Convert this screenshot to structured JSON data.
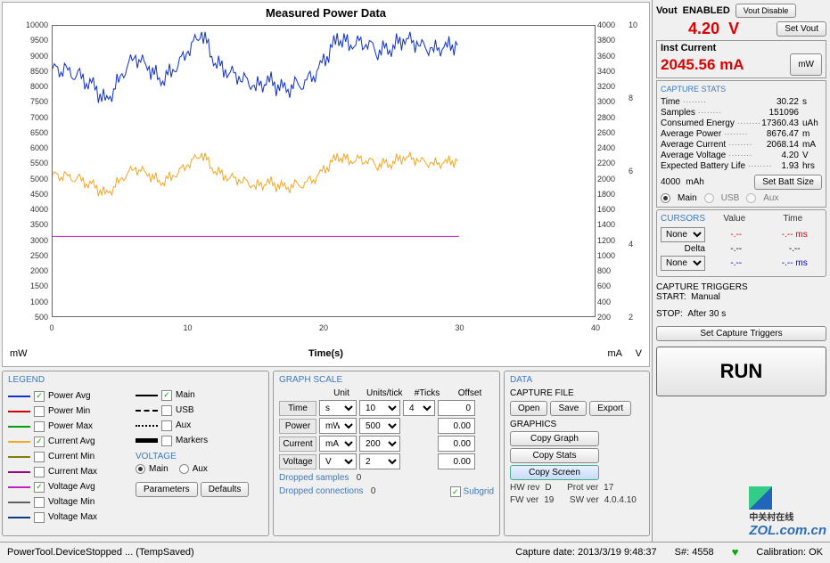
{
  "chart": {
    "title": "Measured Power Data",
    "xlabel": "Time(s)",
    "left_unit": "mW",
    "right_unit1": "mA",
    "right_unit2": "V",
    "x_ticks": [
      0,
      10,
      20,
      30,
      40
    ],
    "y_left_ticks": [
      500,
      1000,
      1500,
      2000,
      2500,
      3000,
      3500,
      4000,
      4500,
      5000,
      5500,
      6000,
      6500,
      7000,
      7500,
      8000,
      8500,
      9000,
      9500,
      10000
    ],
    "y_right1_ticks": [
      200,
      400,
      600,
      800,
      1000,
      1200,
      1400,
      1600,
      1800,
      2000,
      2200,
      2400,
      2600,
      2800,
      3000,
      3200,
      3400,
      3600,
      3800,
      4000
    ],
    "y_right2_ticks": [
      2,
      4,
      6,
      8,
      10
    ]
  },
  "chart_data": {
    "type": "line",
    "title": "Measured Power Data",
    "xlabel": "Time(s)",
    "xlim": [
      0,
      40
    ],
    "series": [
      {
        "name": "Power Avg",
        "unit": "mW",
        "ylim": [
          500,
          10000
        ],
        "color": "#1030d0",
        "x": [
          0,
          1,
          2,
          3,
          4,
          5,
          6,
          7,
          8,
          9,
          10,
          11,
          12,
          13,
          14,
          15,
          16,
          17,
          18,
          19,
          20,
          21,
          22,
          23,
          24,
          25,
          26,
          27,
          28,
          29,
          30
        ],
        "y": [
          8600,
          8500,
          8300,
          8000,
          7500,
          8300,
          9000,
          8700,
          8200,
          8600,
          9200,
          9800,
          8800,
          8500,
          8300,
          8000,
          8200,
          7900,
          8000,
          8200,
          8800,
          9600,
          9400,
          9500,
          9200,
          9300,
          9600,
          9400,
          9200,
          9300,
          9400
        ]
      },
      {
        "name": "Current Avg",
        "unit": "mA",
        "ylim": [
          200,
          4000
        ],
        "color": "#f5a623",
        "x": [
          0,
          1,
          2,
          3,
          4,
          5,
          6,
          7,
          8,
          9,
          10,
          11,
          12,
          13,
          14,
          15,
          16,
          17,
          18,
          19,
          20,
          21,
          22,
          23,
          24,
          25,
          26,
          27,
          28,
          29,
          30
        ],
        "y": [
          2050,
          2020,
          1980,
          1900,
          1790,
          1980,
          2140,
          2070,
          1950,
          2050,
          2190,
          2330,
          2100,
          2020,
          1980,
          1900,
          1950,
          1880,
          1900,
          1950,
          2100,
          2290,
          2240,
          2260,
          2190,
          2210,
          2290,
          2240,
          2190,
          2210,
          2240
        ]
      },
      {
        "name": "Voltage Avg",
        "unit": "V",
        "ylim": [
          2,
          10
        ],
        "color": "#c020c0",
        "x": [
          0,
          30
        ],
        "y": [
          4.2,
          4.2
        ]
      }
    ]
  },
  "legend": {
    "title": "LEGEND",
    "left": [
      {
        "label": "Power Avg",
        "color": "#1030d0",
        "checked": true
      },
      {
        "label": "Power Min",
        "color": "#d00000",
        "checked": false
      },
      {
        "label": "Power Max",
        "color": "#00a000",
        "checked": false
      },
      {
        "label": "Current Avg",
        "color": "#f5a623",
        "checked": true
      },
      {
        "label": "Current Min",
        "color": "#808000",
        "checked": false
      },
      {
        "label": "Current Max",
        "color": "#a00080",
        "checked": false
      },
      {
        "label": "Voltage Avg",
        "color": "#c020c0",
        "checked": true
      },
      {
        "label": "Voltage Min",
        "color": "#606060",
        "checked": false
      },
      {
        "label": "Voltage Max",
        "color": "#004080",
        "checked": false
      }
    ],
    "right": [
      {
        "label": "Main",
        "style": "solid",
        "checked": true
      },
      {
        "label": "USB",
        "style": "dashed",
        "checked": false
      },
      {
        "label": "Aux",
        "style": "dotted",
        "checked": false
      },
      {
        "label": "Markers",
        "style": "thick",
        "checked": false
      }
    ],
    "voltage_label": "VOLTAGE",
    "voltage_main": "Main",
    "voltage_aux": "Aux",
    "btn_params": "Parameters",
    "btn_defaults": "Defaults"
  },
  "graphscale": {
    "title": "GRAPH SCALE",
    "hdr_unit": "Unit",
    "hdr_upt": "Units/tick",
    "hdr_ticks": "#Ticks",
    "hdr_off": "Offset",
    "rows": [
      {
        "label": "Time",
        "unit": "s",
        "upt": "10",
        "ticks": "4",
        "off": "0"
      },
      {
        "label": "Power",
        "unit": "mW",
        "upt": "500",
        "ticks": "",
        "off": "0.00"
      },
      {
        "label": "Current",
        "unit": "mA",
        "upt": "200",
        "ticks": "",
        "off": "0.00"
      },
      {
        "label": "Voltage",
        "unit": "V",
        "upt": "2",
        "ticks": "",
        "off": "0.00"
      }
    ],
    "dropped_samples_lbl": "Dropped samples",
    "dropped_samples": "0",
    "dropped_conn_lbl": "Dropped connections",
    "dropped_conn": "0",
    "subgrid": "Subgrid"
  },
  "data": {
    "title": "DATA",
    "capfile": "CAPTURE FILE",
    "open": "Open",
    "save": "Save",
    "export": "Export",
    "graphics": "GRAPHICS",
    "copygraph": "Copy Graph",
    "copystats": "Copy Stats",
    "copyscreen": "Copy Screen",
    "hw_lbl": "HW rev",
    "hw": "D",
    "fw_lbl": "FW ver",
    "fw": "19",
    "prot_lbl": "Prot ver",
    "prot": "17",
    "sw_lbl": "SW ver",
    "sw": "4.0.4.10"
  },
  "right": {
    "vout_lbl": "Vout",
    "enabled": "ENABLED",
    "vout_val": "4.20",
    "vout_unit": "V",
    "btn_disable": "Vout Disable",
    "btn_setvout": "Set Vout",
    "inst_lbl": "Inst Current",
    "inst_val": "2045.56",
    "inst_unit": "mA",
    "btn_mw": "mW",
    "stats_title": "CAPTURE STATS",
    "stats": [
      {
        "k": "Time",
        "v": "30.22",
        "u": "s"
      },
      {
        "k": "Samples",
        "v": "151096",
        "u": ""
      },
      {
        "k": "Consumed Energy",
        "v": "17360.43",
        "u": "uAh"
      },
      {
        "k": "Average Power",
        "v": "8676.47",
        "u": "m"
      },
      {
        "k": "Average Current",
        "v": "2068.14",
        "u": "mA"
      },
      {
        "k": "Average Voltage",
        "v": "4.20",
        "u": "V"
      },
      {
        "k": "Expected Battery Life",
        "v": "1.93",
        "u": "hrs"
      }
    ],
    "batt_val": "4000",
    "batt_unit": "mAh",
    "btn_batt": "Set Batt Size",
    "src_main": "Main",
    "src_usb": "USB",
    "src_aux": "Aux",
    "cursors_title": "CURSORS",
    "cur_value": "Value",
    "cur_time": "Time",
    "cur_none": "None",
    "cur_delta": "Delta",
    "cur_dash": "-.--",
    "cur_ms": "ms",
    "trig_title": "CAPTURE TRIGGERS",
    "trig_start_lbl": "START:",
    "trig_start": "Manual",
    "trig_stop_lbl": "STOP:",
    "trig_stop": "After 30 s",
    "btn_trig": "Set Capture Triggers",
    "run": "RUN"
  },
  "status": {
    "device": "PowerTool.DeviceStopped ... (TempSaved)",
    "capture": "Capture date: 2013/3/19 9:48:37",
    "serial": "S#: 4558",
    "calib": "Calibration: OK"
  },
  "watermark": {
    "cn": "中关村在线",
    "en": "ZOL.com.cn"
  }
}
